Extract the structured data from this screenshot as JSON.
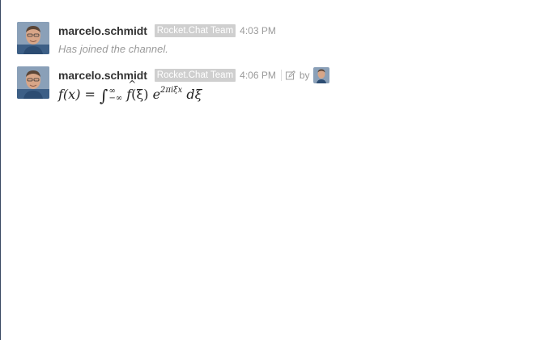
{
  "messages": [
    {
      "username": "marcelo.schmidt",
      "role": "Rocket.Chat Team",
      "time": "4:03 PM",
      "system_text": "Has joined the channel."
    },
    {
      "username": "marcelo.schmidt",
      "role": "Rocket.Chat Team",
      "time": "4:06 PM",
      "edited_by_label": "by",
      "edit_icon": "pencil-square-icon",
      "math": {
        "lhs": "f(x) =",
        "integral": "∫",
        "upper_limit": "∞",
        "lower_limit": "−∞",
        "function": "f",
        "argument": "(ξ)",
        "exp_base": "e",
        "exponent": "2πiξx",
        "differential": "dξ"
      }
    }
  ],
  "colors": {
    "role_badge_bg": "#cfcfcf",
    "timestamp": "#9a9a9a",
    "username": "#333333",
    "left_border": "#3a4a63"
  }
}
